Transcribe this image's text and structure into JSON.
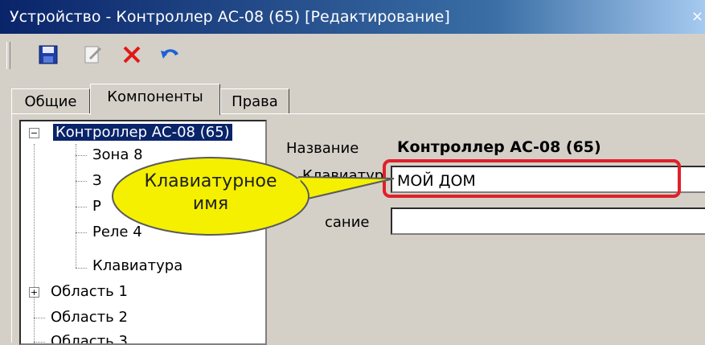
{
  "window": {
    "title": "Устройство - Контроллер АС-08 (65) [Редактирование]",
    "close": "×"
  },
  "toolbar": {
    "icons": [
      "save-icon",
      "edit-icon",
      "delete-icon",
      "undo-icon"
    ]
  },
  "tabs": [
    {
      "label": "Общие"
    },
    {
      "label": "Компоненты"
    },
    {
      "label": "Права"
    }
  ],
  "tree": {
    "root": {
      "label": "Контроллер АС-08 (65)",
      "expander": "−"
    },
    "children": [
      {
        "label": "Зона 8"
      },
      {
        "label": "З"
      },
      {
        "label": "Р"
      },
      {
        "label": "Реле 4"
      },
      {
        "label": "Клавиатура"
      }
    ],
    "areas": [
      {
        "label": "Область 1",
        "expander": "+"
      },
      {
        "label": "Область 2"
      },
      {
        "label": "Область 3"
      }
    ]
  },
  "form": {
    "name_label": "Название",
    "name_value": "Контроллер АС-08 (65)",
    "keyboard_label": "Клавиатур",
    "keyboard_value": "МОЙ ДОМ",
    "description_label": "сание",
    "description_value": ""
  },
  "callout": {
    "line1": "Клавиатурное",
    "line2": "имя"
  },
  "colors": {
    "titlebar": "#0a246a",
    "highlight": "#e0202a",
    "callout_fill": "#f4f000"
  }
}
